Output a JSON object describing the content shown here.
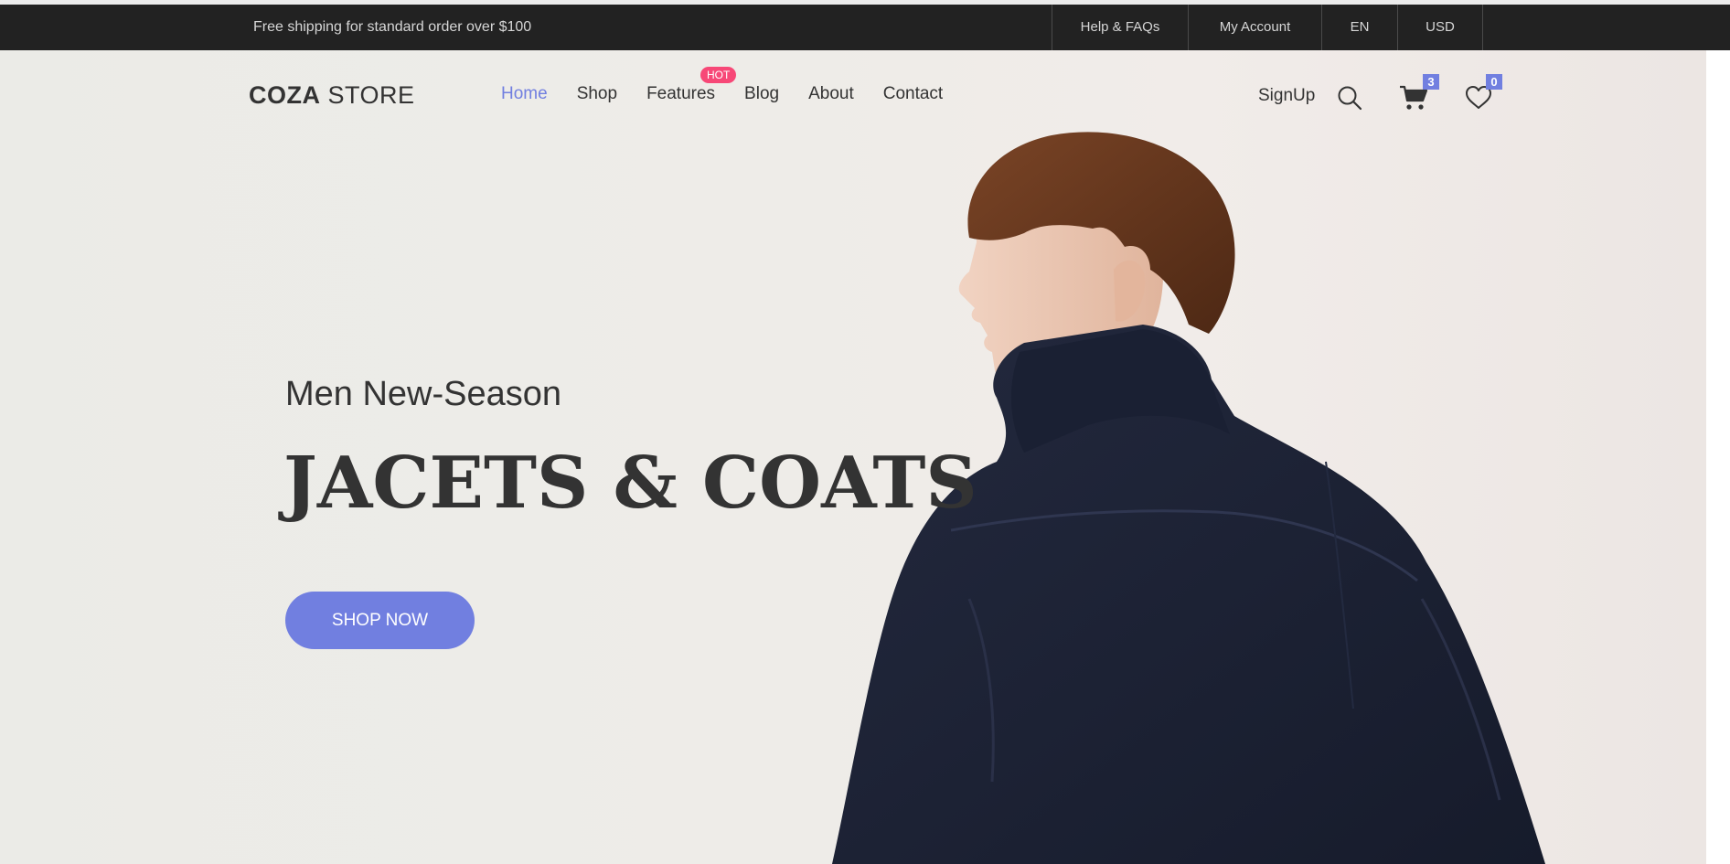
{
  "topbar": {
    "promo": "Free shipping for standard order over $100",
    "help": "Help & FAQs",
    "account": "My Account",
    "language": "EN",
    "currency": "USD"
  },
  "header": {
    "logo_bold": "COZA",
    "logo_rest": " STORE",
    "nav": {
      "home": "Home",
      "shop": "Shop",
      "features": "Features",
      "blog": "Blog",
      "about": "About",
      "contact": "Contact"
    },
    "hot_badge": "HOT",
    "signup": "SignUp",
    "cart_count": "3",
    "wishlist_count": "0",
    "icons": [
      "search-icon",
      "cart-icon",
      "heart-icon"
    ]
  },
  "hero": {
    "subtitle": "Men New-Season",
    "title": "JACETS & COATS",
    "button": "SHOP NOW"
  },
  "colors": {
    "accent": "#717fe0",
    "hot": "#f74877",
    "topbar": "#222222",
    "text": "#333333",
    "jacket": "#1c2336",
    "hair": "#6b3a22"
  }
}
